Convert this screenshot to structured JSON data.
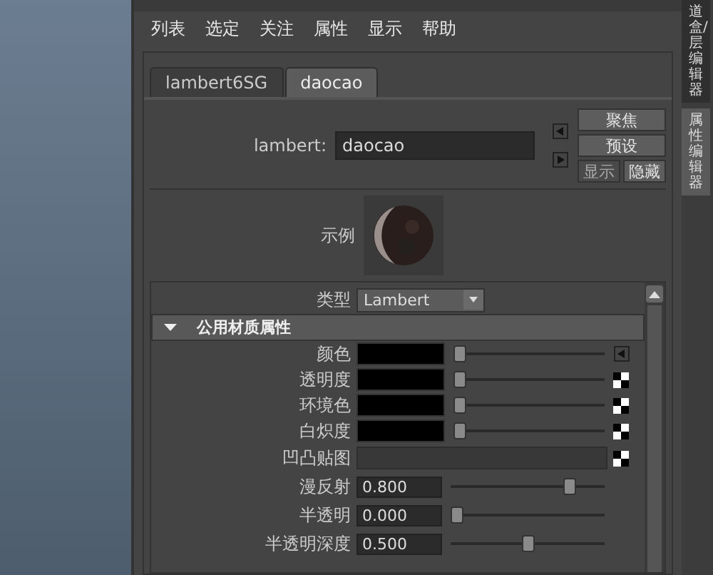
{
  "menu": [
    "列表",
    "选定",
    "关注",
    "属性",
    "显示",
    "帮助"
  ],
  "tabs": [
    {
      "label": "lambert6SG",
      "selected": false
    },
    {
      "label": "daocao",
      "selected": true
    }
  ],
  "name_field": {
    "label": "lambert:",
    "value": "daocao"
  },
  "buttons": [
    {
      "label": "聚焦",
      "disabled": false
    },
    {
      "label": "预设",
      "disabled": false
    },
    {
      "label": "显示",
      "disabled": true
    },
    {
      "label": "隐藏",
      "disabled": false
    }
  ],
  "sample": {
    "label": "示例"
  },
  "type": {
    "label": "类型",
    "value": "Lambert"
  },
  "section": {
    "title": "公用材质属性",
    "expanded": true
  },
  "attributes": [
    {
      "kind": "color",
      "label": "颜色",
      "level": 0
    },
    {
      "kind": "color",
      "label": "透明度",
      "level": 0
    },
    {
      "kind": "color",
      "label": "环境色",
      "level": 0
    },
    {
      "kind": "color",
      "label": "白炽度",
      "level": 0
    },
    {
      "kind": "map",
      "label": "凹凸贴图"
    },
    {
      "kind": "number",
      "label": "漫反射",
      "value": "0.800",
      "level": 0.8
    },
    {
      "kind": "number",
      "label": "半透明",
      "value": "0.000",
      "level": 0
    },
    {
      "kind": "number",
      "label": "半透明深度",
      "value": "0.500",
      "level": 0.5
    }
  ],
  "side_tabs": [
    {
      "label": "道盒/层编辑器",
      "selected": false
    },
    {
      "label": "属性编辑器",
      "selected": true
    }
  ]
}
